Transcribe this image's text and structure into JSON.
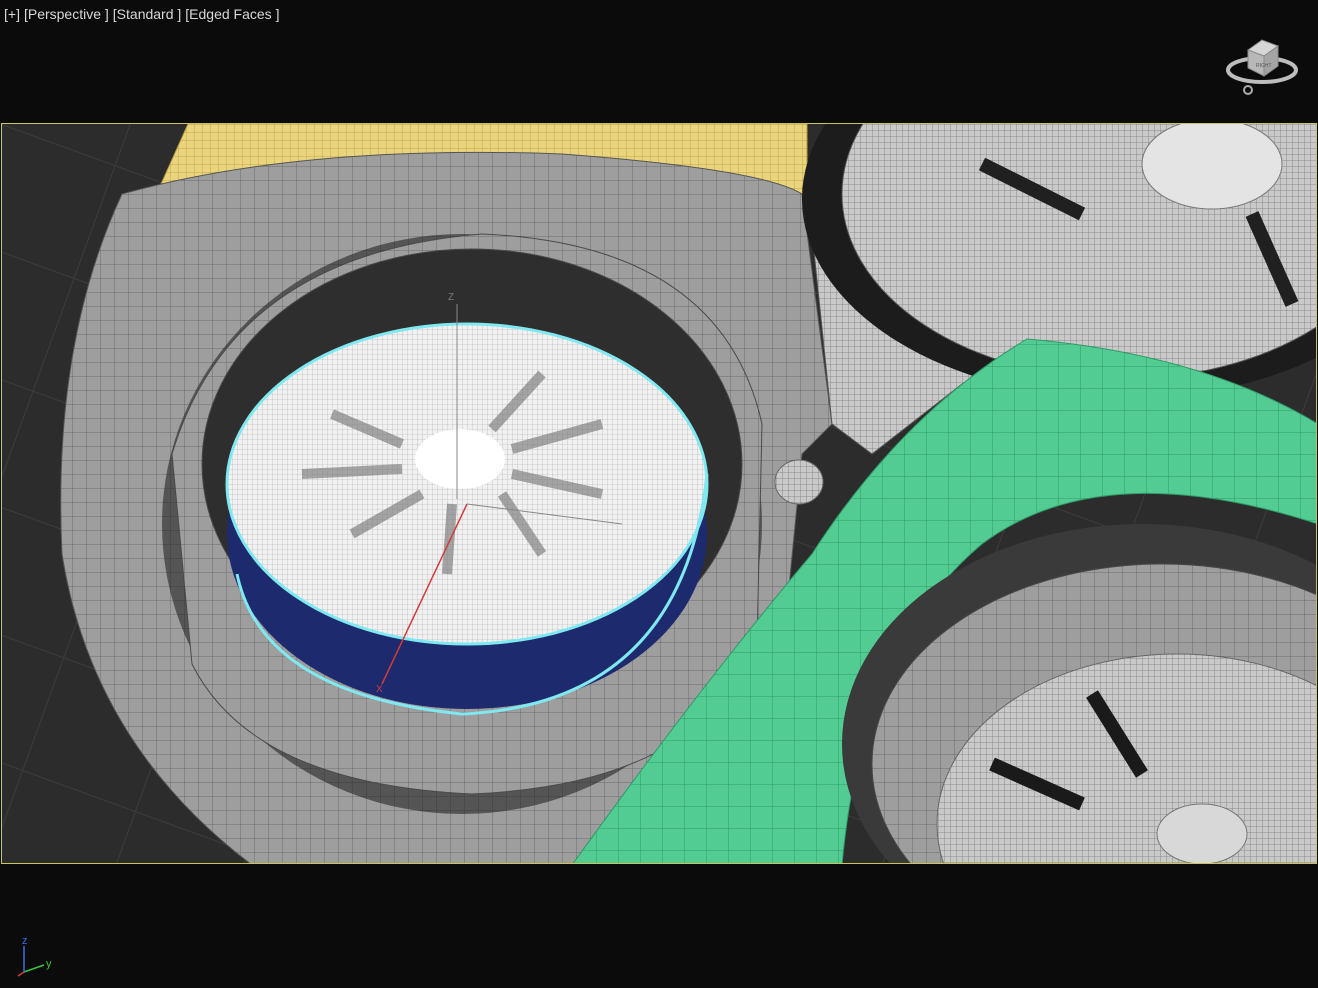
{
  "viewport": {
    "labels": [
      "[+]",
      "[Perspective ]",
      "[Standard ]",
      "[Edged Faces ]"
    ]
  },
  "viewcube": {
    "face_label": "RIGHT"
  },
  "transform_gizmo": {
    "axis_z": "Z",
    "axis_x": "X"
  },
  "axis_gizmo": {
    "axis_z": "z",
    "axis_y": "y"
  },
  "colors": {
    "background": "#0b0b0b",
    "viewport_border": "#c8c65a",
    "selection_outline": "#7fe8f0",
    "yellow_mesh": "#e8d27a",
    "green_mesh": "#4fc98f",
    "grey_mesh": "#9a9a9a",
    "wire": "#5a5a5a"
  }
}
